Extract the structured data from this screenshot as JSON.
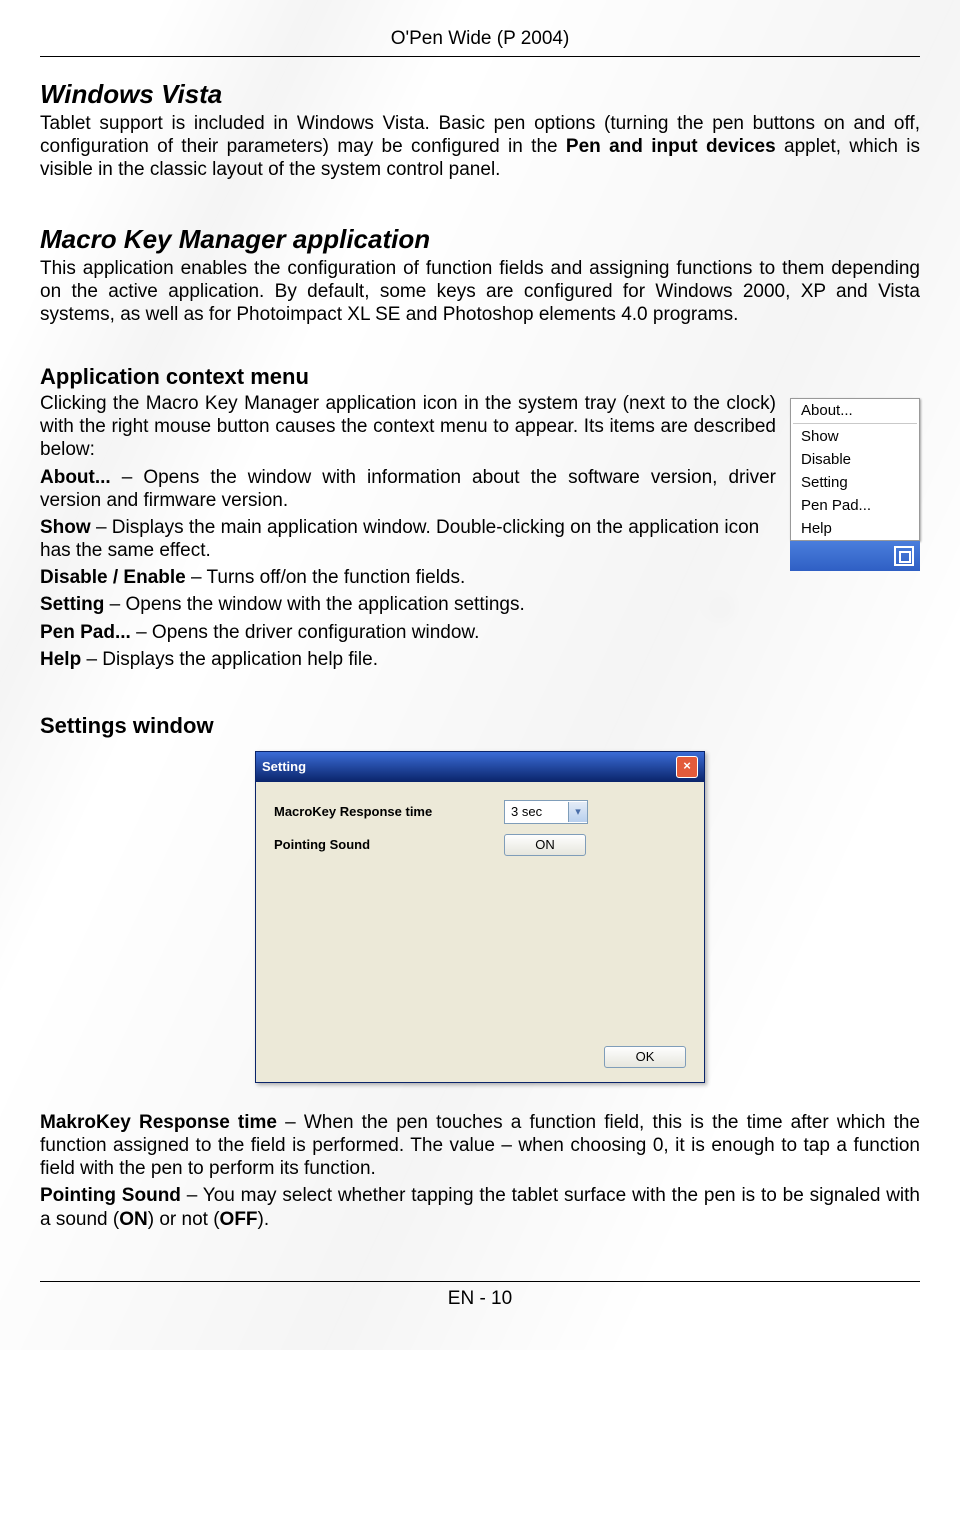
{
  "doc": {
    "header": "O'Pen Wide (P 2004)",
    "footer": "EN - 10"
  },
  "vista": {
    "title": "Windows Vista",
    "p1_a": "Tablet support is included in Windows Vista. Basic pen options (turning the pen buttons on and off, configuration of their parameters) may be configured in the ",
    "p1_bold": "Pen and input devices",
    "p1_b": " applet, which is visible in the classic layout of the system control panel."
  },
  "mkm": {
    "title": "Macro Key Manager application",
    "p1": "This application enables the configuration of function fields and assigning functions to them depending on the active application. By default, some keys are configured for Windows 2000, XP and Vista systems, as well as for Photoimpact XL SE and Photoshop elements 4.0 programs."
  },
  "ctx": {
    "title": "Application context menu",
    "intro": "Clicking the Macro Key Manager application icon in the system tray (next to the clock) with the right mouse button causes the context menu to appear. Its items are described below:",
    "items": {
      "about_b": "About...",
      "about_t": " – Opens the window with information about the software version, driver version and firmware version.",
      "show_b": "Show",
      "show_t": " – Displays the main application window. Double-clicking on the application icon has the same effect.",
      "disable_b": "Disable / Enable",
      "disable_t": " – Turns off/on the function fields.",
      "setting_b": "Setting",
      "setting_t": " – Opens the window with the application settings.",
      "penpad_b": "Pen Pad...",
      "penpad_t": " – Opens the driver configuration window.",
      "help_b": "Help",
      "help_t": " – Displays the application help file."
    },
    "menu": [
      "About...",
      "Show",
      "Disable",
      "Setting",
      "Pen Pad...",
      "Help"
    ]
  },
  "settings": {
    "title": "Settings window",
    "dialog": {
      "title": "Setting",
      "close_label": "×",
      "row1_label": "MacroKey Response time",
      "row1_value": "3 sec",
      "row2_label": "Pointing Sound",
      "row2_value": "ON",
      "ok": "OK"
    },
    "desc1_b": "MakroKey Response time",
    "desc1_t": " – When the pen touches a function field, this is the time after which the function assigned to the field is performed. The value – when choosing 0, it is enough to tap a function field with the pen to perform its function.",
    "desc2_b": "Pointing Sound",
    "desc2_ta": " – You may select whether tapping the tablet surface with the pen is to be signaled with a sound (",
    "desc2_on": "ON",
    "desc2_tb": ") or not (",
    "desc2_off": "OFF",
    "desc2_tc": ")."
  }
}
